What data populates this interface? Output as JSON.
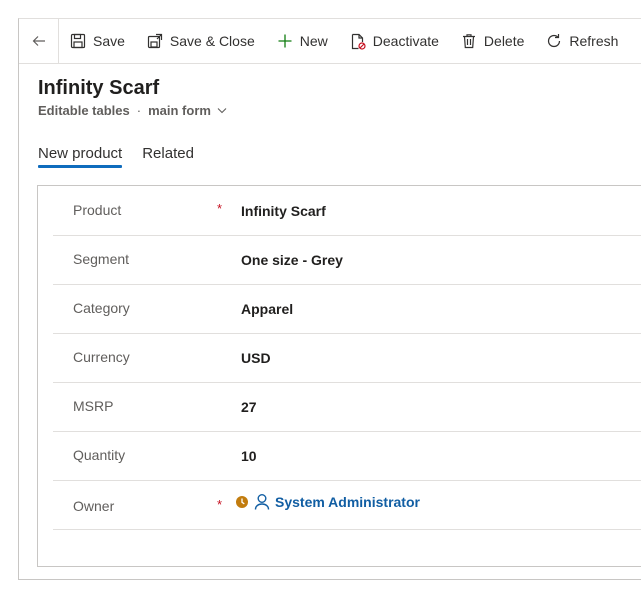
{
  "toolbar": {
    "save_label": "Save",
    "save_close_label": "Save & Close",
    "new_label": "New",
    "deactivate_label": "Deactivate",
    "delete_label": "Delete",
    "refresh_label": "Refresh"
  },
  "header": {
    "title": "Infinity Scarf",
    "entity": "Editable tables",
    "separator": "·",
    "form_name": "main form"
  },
  "tabs": [
    {
      "label": "New product",
      "active": true
    },
    {
      "label": "Related",
      "active": false
    }
  ],
  "fields": [
    {
      "label": "Product",
      "required": "*",
      "value": "Infinity Scarf"
    },
    {
      "label": "Segment",
      "required": "",
      "value": "One size - Grey"
    },
    {
      "label": "Category",
      "required": "",
      "value": "Apparel"
    },
    {
      "label": "Currency",
      "required": "",
      "value": "USD"
    },
    {
      "label": "MSRP",
      "required": "",
      "value": "27"
    },
    {
      "label": "Quantity",
      "required": "",
      "value": "10"
    },
    {
      "label": "Owner",
      "required": "*",
      "value": "System Administrator"
    }
  ],
  "colors": {
    "accent": "#0f6cbd",
    "link": "#115ea3",
    "required": "#c50f1f",
    "presence": "#c27c0e"
  },
  "icons": {
    "back": "arrow-left-icon",
    "save": "floppy-disk-icon",
    "save_close": "save-close-icon",
    "new": "plus-icon",
    "deactivate": "document-deactivate-icon",
    "delete": "trash-icon",
    "refresh": "refresh-icon",
    "presence": "presence-away-icon",
    "user": "person-icon"
  }
}
